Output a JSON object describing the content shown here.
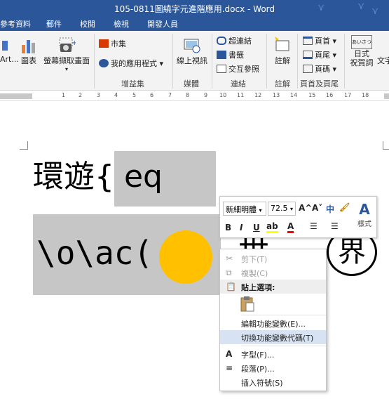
{
  "window": {
    "title": "105-0811圖繞字元進階應用.docx - Word"
  },
  "tabs": [
    "參考資料",
    "郵件",
    "校閱",
    "檢視",
    "開發人員"
  ],
  "ribbon": {
    "art_label": "Art...",
    "chart_label": "圖表",
    "screenshot_label": "螢幕擷取畫面",
    "store_label": "市集",
    "my_apps_label": "我的應用程式",
    "addins_group": "增益集",
    "online_video_label": "線上視訊",
    "media_group": "媒體",
    "hyperlink_label": "超連結",
    "bookmark_label": "書籤",
    "crossref_label": "交互參照",
    "links_group": "連結",
    "comment_label": "註解",
    "comments_group": "註解",
    "header_label": "頁首",
    "footer_label": "頁尾",
    "pagenum_label": "頁碼",
    "hf_group": "頁首及頁尾",
    "japanese_label": "日式\n祝賀詞",
    "japanese_icon_text": "あいさつ",
    "text_label": "文字"
  },
  "ruler": {
    "labels": [
      "1",
      "2",
      "3",
      "4",
      "5",
      "6",
      "7",
      "8",
      "9",
      "10",
      "11",
      "12",
      "13",
      "14",
      "15",
      "16",
      "17",
      "18"
    ]
  },
  "document": {
    "line1_text": "環遊{ eq",
    "line2_text": "\\o\\ac(",
    "partial_text": "世",
    "enclosed_char": "界"
  },
  "mini_toolbar": {
    "font_name": "新細明體",
    "font_size": "72.5",
    "grow_label": "A^",
    "shrink_label": "A˅",
    "phonetic_label": "中",
    "bold": "B",
    "italic": "I",
    "underline": "U",
    "styles_label": "樣式"
  },
  "context_menu": {
    "items": [
      {
        "label": "剪下(T)",
        "icon": "✂"
      },
      {
        "label": "複製(C)",
        "icon": "⧉"
      },
      {
        "label": "貼上選項:",
        "icon": "📋"
      },
      {
        "label": "編輯功能變數(E)..."
      },
      {
        "label": "切換功能變數代碼(T)"
      },
      {
        "label": "字型(F)...",
        "icon": "A"
      },
      {
        "label": "段落(P)...",
        "icon": "≡"
      },
      {
        "label": "插入符號(S)"
      }
    ]
  },
  "colors": {
    "titlebar": "#2b579a",
    "highlight": "#c6c6c6",
    "sun": "#ffc000",
    "menu_hover": "#d7e3f3"
  }
}
